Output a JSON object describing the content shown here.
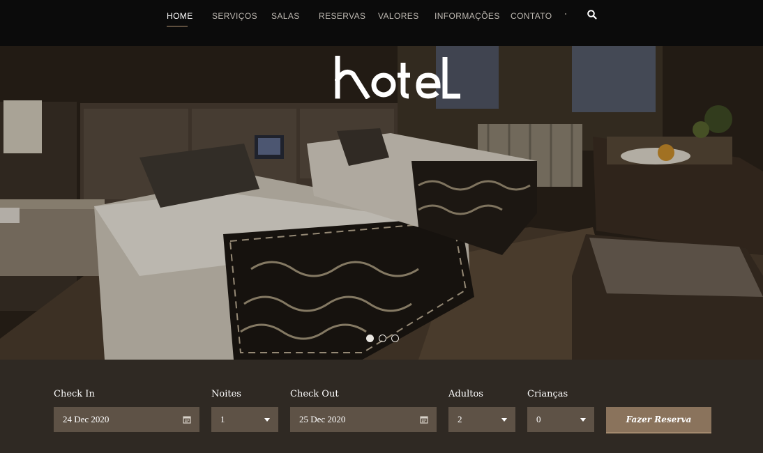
{
  "nav": {
    "items": [
      {
        "label": "HOME",
        "active": true
      },
      {
        "label": "SERVIÇOS"
      },
      {
        "label": "SALAS"
      },
      {
        "label": "RESERVAS"
      },
      {
        "label": "VALORES"
      },
      {
        "label": "INFORMAÇÕES"
      },
      {
        "label": "CONTATO"
      }
    ],
    "search_icon": "search-icon"
  },
  "hero": {
    "logo_text": "hotel",
    "slides": 3,
    "active_slide": 1
  },
  "booking": {
    "check_in": {
      "label": "Check In",
      "value": "24 Dec 2020",
      "icon": "calendar-icon"
    },
    "nights": {
      "label": "Noites",
      "value": "1",
      "icon": "chevron-down-icon"
    },
    "check_out": {
      "label": "Check Out",
      "value": "25 Dec 2020",
      "icon": "calendar-icon"
    },
    "adults": {
      "label": "Adultos",
      "value": "2",
      "icon": "chevron-down-icon"
    },
    "children": {
      "label": "Crianças",
      "value": "0",
      "icon": "chevron-down-icon"
    },
    "submit_label": "Fazer Reserva"
  },
  "colors": {
    "nav_bg": "#0b0b0b",
    "accent": "#b99a76",
    "booking_bg": "#2f2923",
    "field_bg": "#5e5246",
    "button_bg": "#8a735c"
  }
}
